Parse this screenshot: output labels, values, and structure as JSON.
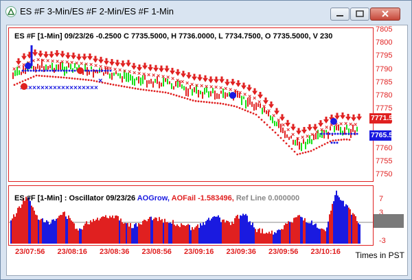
{
  "window": {
    "title": "ES #F 3-Min/ES #F 2-Min/ES #F 1-Min"
  },
  "price_pane": {
    "header": "ES #F [1-Min] 09/23/26  -0.2500 C 7735.5000, H 7736.0000, L 7734.7500, O 7735.5000, V 230",
    "axis_labels": [
      "7805",
      "7800",
      "7795",
      "7790",
      "7785",
      "7780",
      "7775",
      "7770",
      "7765",
      "7760",
      "7755",
      "7750"
    ],
    "tag_top": "7771.50",
    "tag_bottom": "7765.51",
    "colors": {
      "tag_top_bg": "#e02020",
      "tag_bottom_bg": "#1a1ae0"
    }
  },
  "osc_pane": {
    "title_prefix": "ES #F [1-Min] : Oscillator 09/23/26",
    "grow_label": "AOGrow,",
    "fail_label": "AOFail -1.583496,",
    "ref_label": "Ref Line 0.000000",
    "axis_labels": [
      "7",
      "3",
      "0",
      "-3"
    ]
  },
  "x_axis": {
    "ticks": [
      "23/07:56",
      "23/08:16",
      "23/08:36",
      "23/08:56",
      "23/09:16",
      "23/09:36",
      "23/09:56",
      "23/10:16"
    ]
  },
  "footer": {
    "times_label": "Times in PST"
  },
  "colors": {
    "up": "#18e018",
    "down": "#e02020",
    "accent": "#1a1ae0",
    "gray": "#888888"
  }
}
